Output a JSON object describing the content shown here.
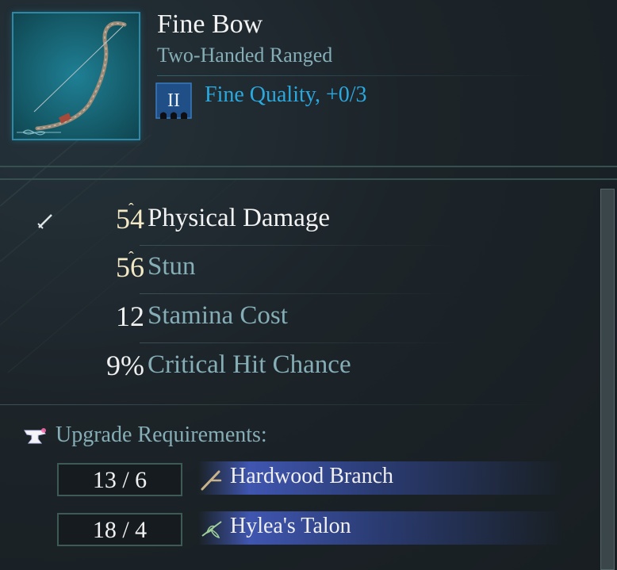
{
  "item": {
    "name": "Fine Bow",
    "type": "Two-Handed Ranged",
    "quality_tier": "II",
    "quality_text": "Fine Quality, +0/3",
    "image_icon": "bow-icon"
  },
  "stats": [
    {
      "value": "54",
      "label": "Physical Damage",
      "improved": true,
      "icon": "sword-icon"
    },
    {
      "value": "56",
      "label": "Stun",
      "improved": true
    },
    {
      "value": "12",
      "label": "Stamina Cost",
      "improved": false
    },
    {
      "value": "9%",
      "label": "Critical Hit Chance",
      "improved": false
    }
  ],
  "upgrade": {
    "title": "Upgrade Requirements:",
    "icon": "anvil-icon",
    "materials": [
      {
        "count": "13 / 6",
        "name": "Hardwood Branch",
        "icon": "branch-icon"
      },
      {
        "count": "18 / 4",
        "name": "Hylea's Talon",
        "icon": "leaf-icon"
      }
    ]
  },
  "colors": {
    "accent_blue": "#2aa9df",
    "label_teal": "#86aeb7",
    "improved_gold": "#f3e9c4",
    "material_band": "#4660c8",
    "thumbnail_teal": "#1f7f94"
  }
}
